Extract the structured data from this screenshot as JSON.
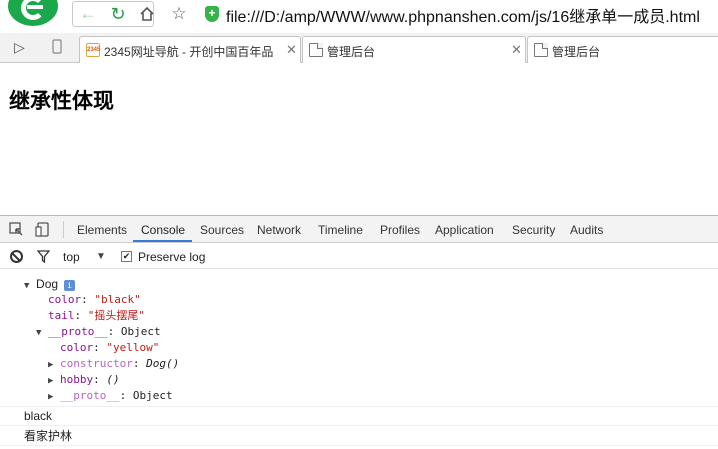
{
  "toolbar": {
    "icons": [
      "browser-logo-icon",
      "back-arrow-icon",
      "reload-icon",
      "home-icon",
      "star-icon",
      "security-shield-icon"
    ],
    "url": "file:///D:/amp/WWW/www.phpnanshen.com/js/16继承单一成员.html",
    "colors": {
      "logo": "#1aa84a",
      "shield": "#35b34a"
    }
  },
  "tabs": [
    {
      "title": "2345网址导航 - 开创中国百年品",
      "favicon": "2345-favicon",
      "favicon_text": "2345"
    },
    {
      "title": "管理后台",
      "favicon": "document-icon"
    },
    {
      "title": "管理后台",
      "favicon": "document-icon"
    }
  ],
  "page": {
    "heading": "继承性体现"
  },
  "devtools": {
    "tabs": [
      "Elements",
      "Console",
      "Sources",
      "Network",
      "Timeline",
      "Profiles",
      "Application",
      "Security",
      "Audits"
    ],
    "active_tab": "Console",
    "filter": {
      "context": "top",
      "preserve_log_label": "Preserve log",
      "preserve_log_checked": true
    },
    "console": {
      "object_name": "Dog",
      "info_badge": "i",
      "props": [
        {
          "key": "color",
          "value": "\"black\""
        },
        {
          "key": "tail",
          "value": "\"摇头摆尾\""
        }
      ],
      "proto": {
        "key": "__proto__",
        "value": "Object",
        "props": [
          {
            "key": "color",
            "value": "\"yellow\""
          }
        ],
        "constructor": {
          "key": "constructor",
          "value": "Dog()"
        },
        "hobby": {
          "key": "hobby",
          "value": "()"
        },
        "inner_proto": {
          "key": "__proto__",
          "value": "Object"
        }
      },
      "logs": [
        "black",
        "看家护林"
      ]
    },
    "accent_color": "#3879d9"
  }
}
